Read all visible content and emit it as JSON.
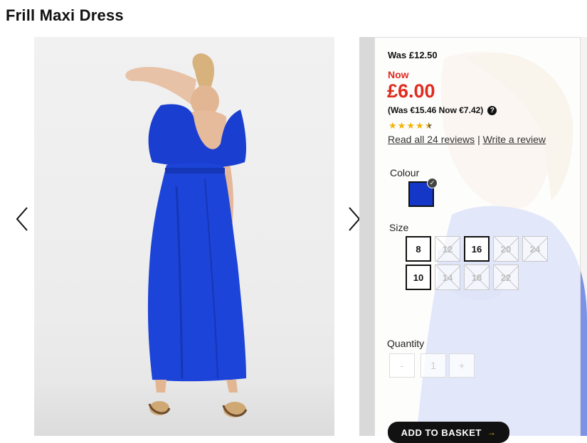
{
  "product": {
    "title": "Frill Maxi Dress"
  },
  "gallery": {
    "prev_icon": "chevron-left-icon",
    "next_icon": "chevron-right-icon",
    "dress_color": "#1a3fd0"
  },
  "pricing": {
    "was": "Was £12.50",
    "now_label": "Now",
    "price": "£6.00",
    "euro": "(Was €15.46 Now €7.42)",
    "help_icon": "?",
    "accent_color": "#e02b1f"
  },
  "rating": {
    "value": 4.5,
    "max": 5,
    "stars_icon": "star-icon"
  },
  "reviews": {
    "read": "Read all 24 reviews",
    "separator": "|",
    "write": "Write a review"
  },
  "colour": {
    "label": "Colour",
    "selected": "#1537c7"
  },
  "size": {
    "label": "Size",
    "options": [
      {
        "label": "8",
        "available": true
      },
      {
        "label": "12",
        "available": false
      },
      {
        "label": "16",
        "available": true
      },
      {
        "label": "20",
        "available": false
      },
      {
        "label": "24",
        "available": false
      },
      {
        "label": "10",
        "available": true
      },
      {
        "label": "14",
        "available": false
      },
      {
        "label": "18",
        "available": false
      },
      {
        "label": "22",
        "available": false
      }
    ]
  },
  "quantity": {
    "label": "Quantity",
    "minus": "-",
    "value": "1",
    "plus": "+"
  },
  "basket": {
    "label": "ADD TO BASKET",
    "arrow": "→"
  }
}
